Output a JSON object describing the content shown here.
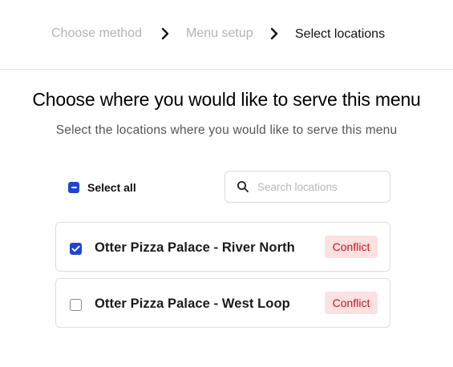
{
  "stepper": {
    "steps": [
      {
        "label": "Choose method",
        "state": "completed"
      },
      {
        "label": "Menu setup",
        "state": "completed"
      },
      {
        "label": "Select locations",
        "state": "current"
      }
    ]
  },
  "header": {
    "title": "Choose where you would like to serve this menu",
    "subtitle": "Select the locations where you would like to serve this menu"
  },
  "toolbar": {
    "select_all_label": "Select all",
    "select_all_state": "indeterminate",
    "search": {
      "placeholder": "Search locations",
      "value": ""
    }
  },
  "locations": [
    {
      "name": "Otter Pizza Palace - River North",
      "checked": true,
      "badge": "Conflict"
    },
    {
      "name": "Otter Pizza Palace - West Loop",
      "checked": false,
      "badge": "Conflict"
    }
  ],
  "colors": {
    "accent": "#1f44d6",
    "conflict_text": "#c5121d",
    "conflict_bg": "#fde1e1",
    "inactive_step": "#b3b3b3",
    "border": "#dedede"
  },
  "icons": {
    "step_separator": "chevron-right-icon",
    "search": "search-icon",
    "checkbox_checked": "checkmark-icon",
    "checkbox_indeterminate": "minus-icon"
  }
}
